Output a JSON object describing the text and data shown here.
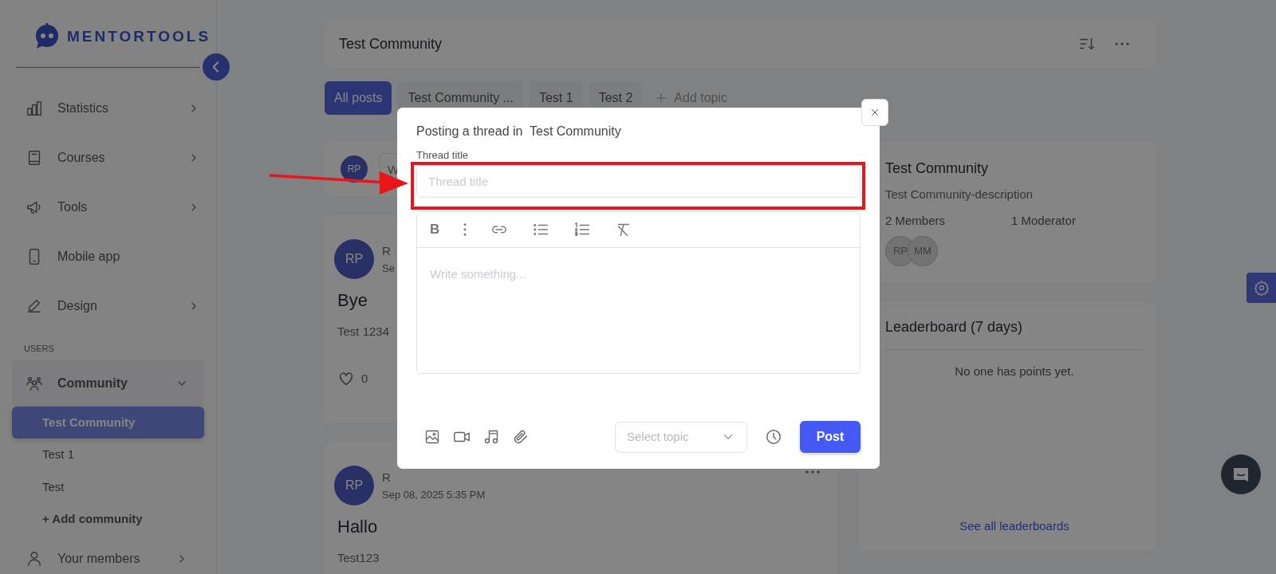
{
  "sidebar": {
    "logo": "MENTORTOOLS",
    "items": [
      {
        "label": "Statistics",
        "has_submenu": true
      },
      {
        "label": "Courses",
        "has_submenu": true
      },
      {
        "label": "Tools",
        "has_submenu": true
      },
      {
        "label": "Mobile app",
        "has_submenu": false
      },
      {
        "label": "Design",
        "has_submenu": true
      }
    ],
    "users_heading": "USERS",
    "users_items": [
      {
        "label": "Community",
        "has_submenu": true,
        "expanded": true,
        "children": [
          {
            "label": "Test Community",
            "selected": true
          },
          {
            "label": "Test 1",
            "selected": false
          },
          {
            "label": "Test",
            "selected": false
          }
        ],
        "add_link": "+ Add community"
      },
      {
        "label": "Your members",
        "has_submenu": true,
        "expanded": false
      }
    ]
  },
  "header": {
    "title": "Test Community"
  },
  "topics": [
    {
      "label": "All posts",
      "selected": true
    },
    {
      "label": "Test Community ...",
      "selected": false
    },
    {
      "label": "Test 1",
      "selected": false
    },
    {
      "label": "Test 2",
      "selected": false
    }
  ],
  "add_topic": "Add topic",
  "composer": {
    "avatar": "RP",
    "placeholder": "W"
  },
  "posts": [
    {
      "avatar": "RP",
      "author": "R",
      "date": "Se",
      "title": "Bye",
      "body": "Test 1234",
      "likes": "0"
    },
    {
      "avatar": "RP",
      "author": "R",
      "date": "Sep 08, 2025 5:35 PM",
      "title": "Hallo",
      "body": "Test123"
    }
  ],
  "community_card": {
    "name": "Test Community",
    "description": "Test Community-description",
    "members": "2 Members",
    "moderators": "1 Moderator",
    "avatars": [
      "RP",
      "MM"
    ]
  },
  "leaderboard": {
    "title": "Leaderboard (7 days)",
    "empty": "No one has points yet.",
    "link": "See all leaderboards"
  },
  "modal": {
    "heading": "Posting a thread in",
    "community": "Test Community",
    "title_label": "Thread title",
    "title_placeholder": "Thread title",
    "bold_label": "B",
    "editor_placeholder": "Write something...",
    "topic_placeholder": "Select topic",
    "post_button": "Post"
  }
}
